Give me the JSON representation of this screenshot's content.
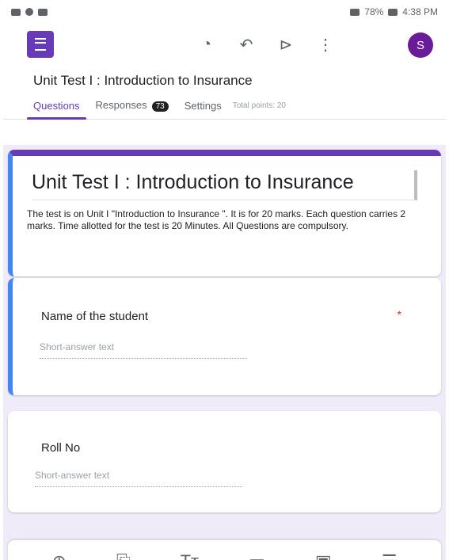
{
  "status_bar": {
    "battery": "78%",
    "time": "4:38 PM"
  },
  "toolbar": {
    "app_icon": "forms-list-icon",
    "icons": [
      "palette-icon",
      "undo-icon",
      "send-icon",
      "more-vert-icon"
    ],
    "avatar_letter": "S"
  },
  "form_title": "Unit Test I : Introduction to Insurance",
  "tabs": {
    "questions": "Questions",
    "responses": "Responses",
    "responses_count": "73",
    "settings": "Settings",
    "total_points": "Total points: 20"
  },
  "header_card": {
    "title": "Unit Test I : Introduction to Insurance",
    "description": "The test is on Unit I \"Introduction to Insurance \". It is for 20 marks. Each question carries 2 marks. Time allotted for the test is 20 Minutes. All Questions are compulsory."
  },
  "questions": [
    {
      "title": "Name of the student",
      "required_mark": "*",
      "placeholder": "Short-answer text"
    },
    {
      "title": "Roll No",
      "placeholder": "Short-answer text"
    }
  ],
  "bottom_toolbar": {
    "icons": [
      "add-question-icon",
      "import-icon",
      "title-text-icon",
      "image-icon",
      "video-icon",
      "section-icon"
    ]
  },
  "colors": {
    "accent": "#673ab7",
    "focus_bar": "#4285f4",
    "canvas": "#f0ebf8"
  }
}
